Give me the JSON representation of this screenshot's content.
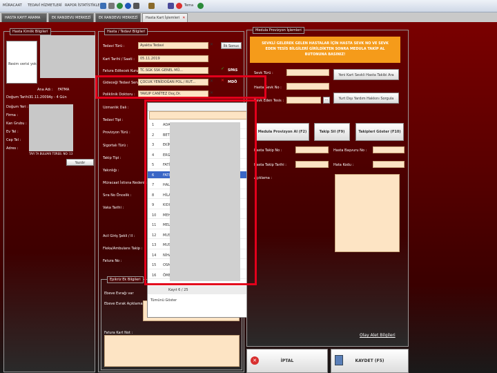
{
  "menu": [
    {
      "label": "MÜRACAAT",
      "icon": "dropdown-icon"
    },
    {
      "label": "TEDAVİ HİZMETLERİ",
      "icon": "dropdown-icon"
    },
    {
      "label": "RAPOR İSTATİSTİKLER",
      "icon": "dropdown-icon"
    }
  ],
  "toolbar_menu_tema": "Tema",
  "tabs": [
    {
      "label": "HASTA KAYIT ARAMA"
    },
    {
      "label": "EK RANDEVU MERKEZİ"
    },
    {
      "label": "EK RANDEVU MERKEZİ"
    },
    {
      "label": "Hasta Kart İşlemleri"
    }
  ],
  "patient": {
    "title": "Hasta Kimlik Bilgileri",
    "photo_placeholder": "Resim verisi yok",
    "labels": [
      "Doğum Tarihi :",
      "Doğum Yeri :",
      "Firma :",
      "Kan Grubu :",
      "Ev Tel :",
      "Cep Tel :",
      "Adres :"
    ],
    "ana_adi_label": "Ana Adı :",
    "ana_adi_value": "FATMA",
    "dob_value": "31.11.2009Ay - 4 Gün",
    "address_value": "TAYI TA BULVARI TÜREB. NO: 13",
    "upload_label": "Yazdır"
  },
  "treatment": {
    "title": "Hasta / Tedavi Bilgileri",
    "fields": [
      {
        "label": "Tedavi Türü :",
        "value": "Ayakta Tedavi"
      },
      {
        "label": "Kart Tarihi / Saati :",
        "value": "05.11.2019"
      },
      {
        "label": "Fatura Edilecek Kurum :",
        "value": "TC.SGK SSK GENEL MÜ..."
      },
      {
        "label": "Gideceği Tedavi Servisi :",
        "value": "ÇOCUK YENİDOĞAN POL./ RUT..."
      },
      {
        "label": "Poliklinik Doktoru :",
        "value": "YAKUP CANİTEZ Doç.Dr."
      },
      {
        "label": "Uzmanlık Dalı :"
      },
      {
        "label": "Tedavi Tipi :"
      },
      {
        "label": "Provizyon Türü :"
      },
      {
        "label": "Sigortalı Türü :"
      },
      {
        "label": "Takip Tipi :"
      },
      {
        "label": "Yakınlığı :"
      },
      {
        "label": "Müracaat İstisna Nedeni :"
      },
      {
        "label": "Sıra No Öncelik :"
      },
      {
        "label": "Vaka Tarihi :"
      },
      {
        "label": "Acil Giriş Şekli / II :"
      },
      {
        "label": "Fleka/Ambulans Takip :"
      },
      {
        "label": "Fatura No :"
      }
    ],
    "ilk_button": "İlk Sonuc",
    "spas_label": "SPAS",
    "mdo_label": "MDÖ",
    "epikriz_title": "Epikriz Ek Bilgileri",
    "epikriz_labels": [
      "Ebeve Evrağı var",
      "Ebeve Evrak Açıklaması :",
      "Fatura Kart Not :"
    ]
  },
  "dropdown": {
    "rows": [
      {
        "n": "1",
        "t": "ADA"
      },
      {
        "n": "2",
        "t": "BETÜL"
      },
      {
        "n": "3",
        "t": "EKİN"
      },
      {
        "n": "4",
        "t": "ERG"
      },
      {
        "n": "5",
        "t": "FATİ"
      },
      {
        "n": "6",
        "t": "FATI"
      },
      {
        "n": "7",
        "t": "HALE"
      },
      {
        "n": "8",
        "t": "HİLA"
      },
      {
        "n": "9",
        "t": "KIDI"
      },
      {
        "n": "10",
        "t": "MEH"
      },
      {
        "n": "11",
        "t": "MELİ"
      },
      {
        "n": "12",
        "t": "MUS"
      },
      {
        "n": "13",
        "t": "MUS"
      },
      {
        "n": "14",
        "t": "NİHA"
      },
      {
        "n": "15",
        "t": "OSM"
      },
      {
        "n": "16",
        "t": "ÖME"
      }
    ],
    "selected_index": 5,
    "record_label": "Kayıt 6 / 25",
    "show_all_label": "Tümünü Göster"
  },
  "medula": {
    "title": "Medula Provizyon İşlemleri",
    "warning": "SEVKLİ GELEREK GELEN HASTALAR İÇİN HASTA SEVK NO VE SEVK EDEN TESİS BİLGİLERİ GİRİLDİKTEN SONRA MEDULA TAKİP AL BUTONUNA BASINIZ!",
    "labels": [
      "Sevk Türü :",
      "Hasta Sevk No :",
      "Sevk Eden Tesis :"
    ],
    "btn_yeni": "Yeni Kart Sevkli Hasta Takibi Ara",
    "btn_yurt": "Yurt Dışı Yardım Hakkını Sorgula",
    "btn_medula": "Medula Provizyon Al (F2)",
    "btn_takip_sil": "Takip Sil (F9)",
    "btn_takipler": "Takipleri Göster (F10)",
    "row_labels": [
      "Hasta Takip No :",
      "Hasta Başvuru No :",
      "Hasta Takip Tarihi :",
      "Hata Kodu :",
      "Açıklama :"
    ],
    "olay_link": "Olay Alet Bilgileri",
    "iptal": "İPTAL",
    "kaydet": "KAYDET (F5)"
  },
  "colors": {
    "highlight": "#e3001b",
    "field": "#fde4c4",
    "warning": "#f59b1a",
    "select": "#3a66c6"
  }
}
